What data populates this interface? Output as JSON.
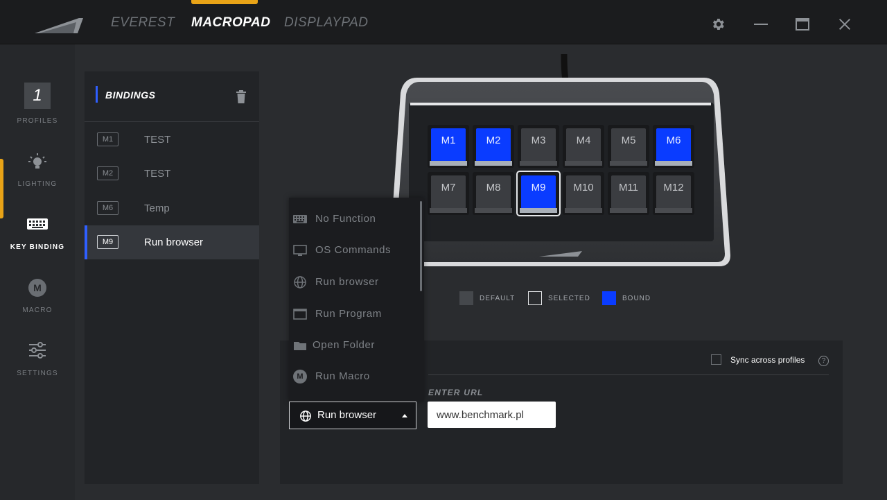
{
  "nav": {
    "tabs": [
      {
        "label": "EVEREST"
      },
      {
        "label": "MACROPAD"
      },
      {
        "label": "DISPLAYPAD"
      }
    ]
  },
  "sidebar": {
    "profile_number": "1",
    "items": [
      {
        "label": "PROFILES",
        "icon": "profile-number-icon"
      },
      {
        "label": "LIGHTING",
        "icon": "bulb-icon"
      },
      {
        "label": "KEY BINDING",
        "icon": "keyboard-icon"
      },
      {
        "label": "MACRO",
        "icon": "macro-icon",
        "icon_text": "M"
      },
      {
        "label": "SETTINGS",
        "icon": "sliders-icon"
      }
    ],
    "active": "KEY BINDING"
  },
  "bindings": {
    "title": "BINDINGS",
    "rows": [
      {
        "key": "M1",
        "name": "TEST"
      },
      {
        "key": "M2",
        "name": "TEST"
      },
      {
        "key": "M6",
        "name": "Temp"
      },
      {
        "key": "M9",
        "name": "Run browser"
      }
    ],
    "selected_key": "M9"
  },
  "macropad": {
    "keys": [
      {
        "label": "M1",
        "state": "bound"
      },
      {
        "label": "M2",
        "state": "bound"
      },
      {
        "label": "M3",
        "state": "default"
      },
      {
        "label": "M4",
        "state": "default"
      },
      {
        "label": "M5",
        "state": "default"
      },
      {
        "label": "M6",
        "state": "bound"
      },
      {
        "label": "M7",
        "state": "default"
      },
      {
        "label": "M8",
        "state": "default"
      },
      {
        "label": "M9",
        "state": "selected-bound"
      },
      {
        "label": "M10",
        "state": "default"
      },
      {
        "label": "M11",
        "state": "default"
      },
      {
        "label": "M12",
        "state": "default"
      }
    ]
  },
  "legend": {
    "default": "DEFAULT",
    "selected": "SELECTED",
    "bound": "BOUND"
  },
  "colors": {
    "accent": "#e8a317",
    "bound_blue": "#0a3cff",
    "selection_blue": "#2f5fff"
  },
  "action_menu": {
    "items": [
      {
        "label": "No Function",
        "icon": "keyboard-icon"
      },
      {
        "label": "OS Commands",
        "icon": "monitor-icon"
      },
      {
        "label": "Run browser",
        "icon": "globe-icon"
      },
      {
        "label": "Run Program",
        "icon": "window-icon"
      },
      {
        "label": "Open Folder",
        "icon": "folder-icon"
      },
      {
        "label": "Run Macro",
        "icon": "macro-icon",
        "icon_text": "M"
      }
    ],
    "selected_value": "Run browser"
  },
  "config": {
    "sync_label": "Sync across profiles",
    "sync_checked": false,
    "help": "?",
    "url_label": "ENTER URL",
    "url_value": "www.benchmark.pl"
  }
}
